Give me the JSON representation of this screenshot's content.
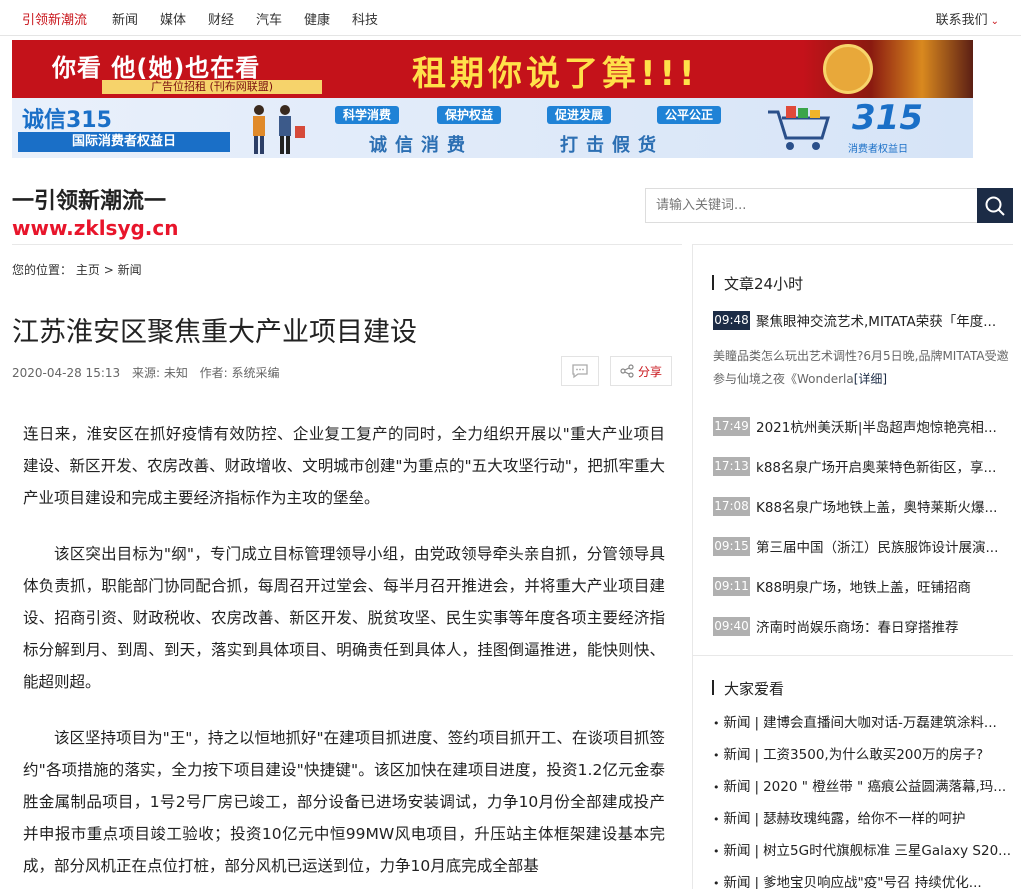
{
  "nav": {
    "items": [
      "引领新潮流",
      "新闻",
      "媒体",
      "财经",
      "汽车",
      "健康",
      "科技"
    ],
    "contact": "联系我们"
  },
  "banners": {
    "ad1": {
      "left": "你看   他(她)也在看",
      "sub": "广告位招租 (刊布网联盟)",
      "big": "租期你说了算!!!"
    },
    "ad2": {
      "title": "诚信315",
      "sub": "国际消费者权益日",
      "tags": [
        "科学消费",
        "保护权益",
        "促进发展",
        "公平公正"
      ],
      "slogan1": "诚信消费",
      "slogan2": "打击假货",
      "logo": "315",
      "logo_sub": "消费者权益日"
    }
  },
  "logo": {
    "title": "一引领新潮流一",
    "url": "www.zklsyg.cn"
  },
  "search": {
    "placeholder": "请输入关键词..."
  },
  "breadcrumb": {
    "label": "您的位置：",
    "home": "主页",
    "sep": ">",
    "current": "新闻"
  },
  "article": {
    "title": "江苏淮安区聚焦重大产业项目建设",
    "date": "2020-04-28 15:13",
    "source": "来源: 未知",
    "author": "作者: 系统采编",
    "share": "分享",
    "paragraphs": [
      " 连日来，淮安区在抓好疫情有效防控、企业复工复产的同时，全力组织开展以\"重大产业项目建设、新区开发、农房改善、财政增收、文明城市创建\"为重点的\"五大攻坚行动\"，把抓牢重大产业项目建设和完成主要经济指标作为主攻的堡垒。",
      "该区突出目标为\"纲\"，专门成立目标管理领导小组，由党政领导牵头亲自抓，分管领导具体负责抓，职能部门协同配合抓，每周召开过堂会、每半月召开推进会，并将重大产业项目建设、招商引资、财政税收、农房改善、新区开发、脱贫攻坚、民生实事等年度各项主要经济指标分解到月、到周、到天，落实到具体项目、明确责任到具体人，挂图倒逼推进，能快则快、能超则超。",
      "该区坚持项目为\"王\"，持之以恒地抓好\"在建项目抓进度、签约项目抓开工、在谈项目抓签约\"各项措施的落实，全力按下项目建设\"快捷键\"。该区加快在建项目进度，投资1.2亿元金泰胜金属制品项目，1号2号厂房已竣工，部分设备已进场安装调试，力争10月份全部建成投产并申报市重点项目竣工验收；投资10亿元中恒99MW风电项目，升压站主体框架建设基本完成，部分风机正在点位打桩，部分风机已运送到位，力争10月底完成全部基"
    ]
  },
  "sidebar": {
    "section1_title": "文章24小时",
    "featured": {
      "time": "09:48",
      "title": "聚焦眼神交流艺术,MITATA荣获「年度...",
      "desc": "美瞳品类怎么玩出艺术调性?6月5日晚,品牌MITATA受邀参与仙境之夜《Wonderla",
      "more": "[详细]"
    },
    "news": [
      {
        "time": "17:49",
        "title": "2021杭州美沃斯|半岛超声炮惊艳亮相..."
      },
      {
        "time": "17:13",
        "title": "k88名泉广场开启奥莱特色新街区，享..."
      },
      {
        "time": "17:08",
        "title": "K88名泉广场地铁上盖，奥特莱斯火爆..."
      },
      {
        "time": "09:15",
        "title": "第三届中国（浙江）民族服饰设计展演..."
      },
      {
        "time": "09:11",
        "title": "K88明泉广场，地铁上盖，旺铺招商"
      },
      {
        "time": "09:40",
        "title": "济南时尚娱乐商场：春日穿搭推荐"
      }
    ],
    "section2_title": "大家爱看",
    "popular": [
      {
        "cat": "新闻",
        "title": "建博会直播间大咖对话-万磊建筑涂料..."
      },
      {
        "cat": "新闻",
        "title": "工资3500,为什么敢买200万的房子?"
      },
      {
        "cat": "新闻",
        "title": "2020 \" 橙丝带 \" 癌痕公益圆满落幕,玛..."
      },
      {
        "cat": "新闻",
        "title": "瑟赫玫瑰纯露，给你不一样的呵护"
      },
      {
        "cat": "新闻",
        "title": "树立5G时代旗舰标准 三星Galaxy S20..."
      },
      {
        "cat": "新闻",
        "title": "爹地宝贝响应战\"疫\"号召 持续优化..."
      }
    ]
  }
}
